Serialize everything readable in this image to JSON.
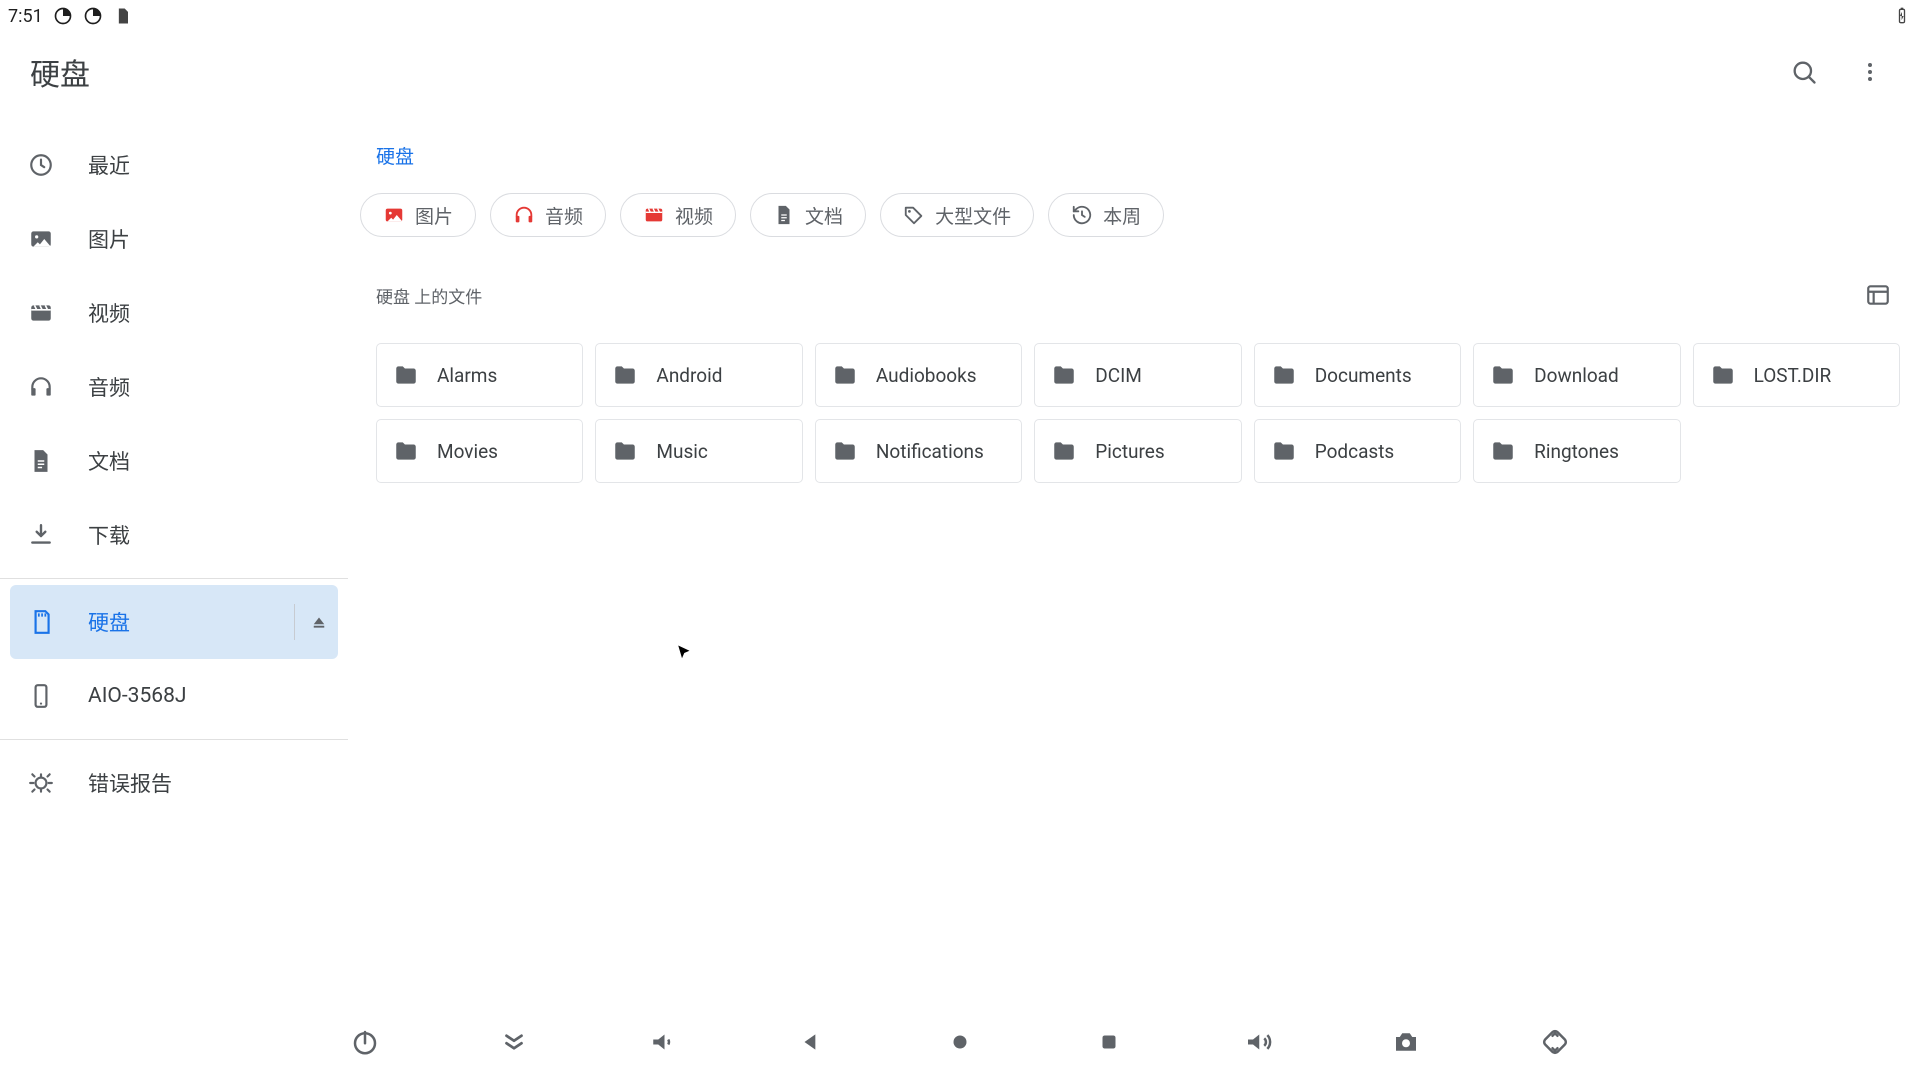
{
  "status": {
    "time": "7:51"
  },
  "header": {
    "title": "硬盘"
  },
  "sidebar": {
    "recent": "最近",
    "images": "图片",
    "videos": "视频",
    "audio": "音频",
    "docs": "文档",
    "downloads": "下载",
    "disk": "硬盘",
    "device": "AIO-3568J",
    "bugreport": "错误报告"
  },
  "breadcrumb": "硬盘",
  "chips": {
    "images": "图片",
    "audio": "音频",
    "videos": "视频",
    "docs": "文档",
    "large": "大型文件",
    "thisweek": "本周"
  },
  "section_label": "硬盘 上的文件",
  "folders": {
    "f0": "Alarms",
    "f1": "Android",
    "f2": "Audiobooks",
    "f3": "DCIM",
    "f4": "Documents",
    "f5": "Download",
    "f6": "LOST.DIR",
    "f7": "Movies",
    "f8": "Music",
    "f9": "Notifications",
    "f10": "Pictures",
    "f11": "Podcasts",
    "f12": "Ringtones"
  },
  "chip_colors": {
    "red": "#e53935",
    "grey": "#5f6368"
  }
}
